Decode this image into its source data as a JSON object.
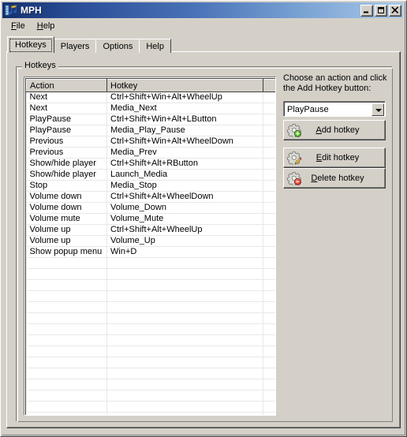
{
  "window": {
    "title": "MPH",
    "icon": "music-note-icon",
    "caption_buttons": [
      {
        "name": "minimize-button",
        "glyph": "_"
      },
      {
        "name": "maximize-button",
        "glyph": "□"
      },
      {
        "name": "close-button",
        "glyph": "×"
      }
    ]
  },
  "menubar": {
    "items": [
      {
        "name": "menu-file",
        "accel": "F",
        "rest": "ile"
      },
      {
        "name": "menu-help",
        "accel": "H",
        "rest": "elp"
      }
    ]
  },
  "tabs": [
    {
      "label": "Hotkeys",
      "selected": true
    },
    {
      "label": "Players",
      "selected": false
    },
    {
      "label": "Options",
      "selected": false
    },
    {
      "label": "Help",
      "selected": false
    }
  ],
  "groupbox": {
    "label": "Hotkeys"
  },
  "listview": {
    "columns": [
      "Action",
      "Hotkey"
    ],
    "rows": [
      [
        "Next",
        "Ctrl+Shift+Win+Alt+WheelUp"
      ],
      [
        "Next",
        "Media_Next"
      ],
      [
        "PlayPause",
        "Ctrl+Shift+Win+Alt+LButton"
      ],
      [
        "PlayPause",
        "Media_Play_Pause"
      ],
      [
        "Previous",
        "Ctrl+Shift+Win+Alt+WheelDown"
      ],
      [
        "Previous",
        "Media_Prev"
      ],
      [
        "Show/hide player",
        "Ctrl+Shift+Alt+RButton"
      ],
      [
        "Show/hide player",
        "Launch_Media"
      ],
      [
        "Stop",
        "Media_Stop"
      ],
      [
        "Volume down",
        "Ctrl+Shift+Alt+WheelDown"
      ],
      [
        "Volume down",
        "Volume_Down"
      ],
      [
        "Volume mute",
        "Volume_Mute"
      ],
      [
        "Volume up",
        "Ctrl+Shift+Alt+WheelUp"
      ],
      [
        "Volume up",
        "Volume_Up"
      ],
      [
        "Show popup menu",
        "Win+D"
      ]
    ],
    "empty_row_count": 15
  },
  "right_panel": {
    "instruction": "Choose an action and click the Add Hotkey button:",
    "combo": {
      "value": "PlayPause"
    },
    "buttons": [
      {
        "name": "add-hotkey-button",
        "accel": "A",
        "before": "",
        "after": "dd hotkey",
        "icon": "gear-plus-icon"
      },
      {
        "name": "edit-hotkey-button",
        "accel": "E",
        "before": "",
        "after": "dit hotkey",
        "icon": "gear-pencil-icon"
      },
      {
        "name": "delete-hotkey-button",
        "accel": "D",
        "before": "",
        "after": "elete hotkey",
        "icon": "gear-minus-icon"
      }
    ]
  },
  "colors": {
    "face": "#d4d0c8",
    "title_left": "#14306e",
    "title_right": "#a9c9e8",
    "window_bg": "#ffffff",
    "accent_add": "#3aa013",
    "accent_delete": "#c81d10",
    "accent_edit": "#e8a317"
  }
}
